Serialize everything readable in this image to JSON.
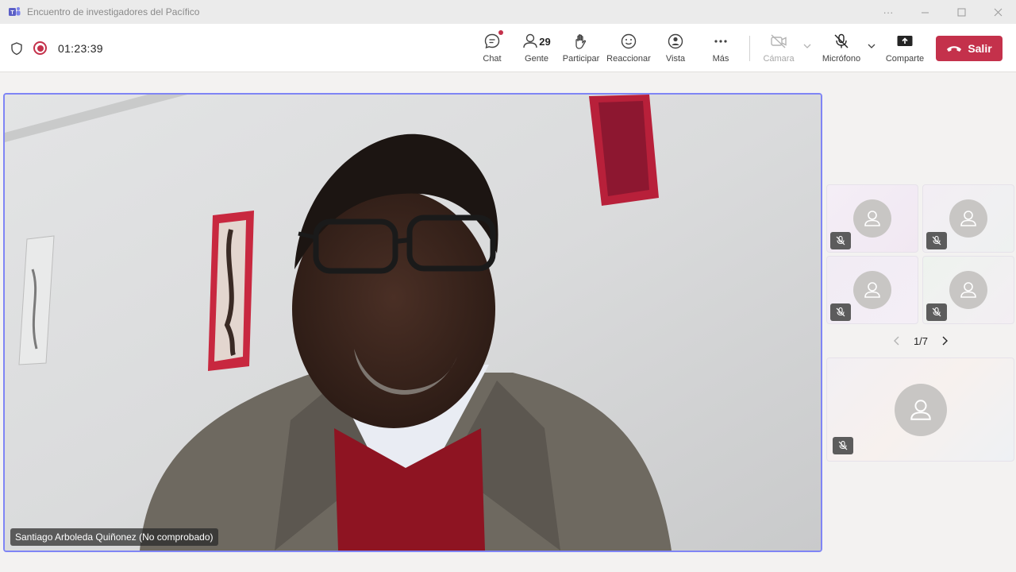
{
  "window": {
    "title": "Encuentro de investigadores del Pacífico"
  },
  "toolbar": {
    "timer": "01:23:39",
    "chat_label": "Chat",
    "people_label": "Gente",
    "people_count": "29",
    "raise_label": "Participar",
    "react_label": "Reaccionar",
    "view_label": "Vista",
    "more_label": "Más",
    "camera_label": "Cámara",
    "mic_label": "Micrófono",
    "share_label": "Comparte",
    "leave_label": "Salir"
  },
  "stage": {
    "speaker_name": "Santiago Arboleda Quiñonez (No comprobado)"
  },
  "gallery": {
    "page_indicator": "1/7",
    "tiles": [
      "participant-1",
      "participant-2",
      "participant-3",
      "participant-4",
      "participant-5"
    ]
  },
  "colors": {
    "accent": "#7f85f5",
    "leave": "#c4314b",
    "teams": "#5b5fc7"
  }
}
